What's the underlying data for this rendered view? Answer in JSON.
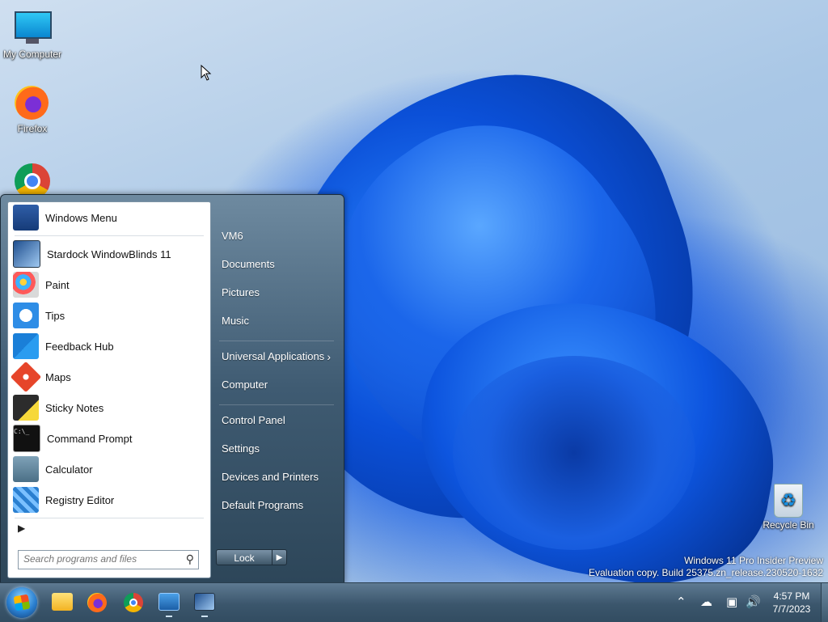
{
  "desktop": {
    "icons": [
      {
        "label": "My Computer"
      },
      {
        "label": "Firefox"
      },
      {
        "label": "Recycle Bin"
      }
    ],
    "watermark_line1": "Windows 11 Pro Insider Preview",
    "watermark_line2": "Evaluation copy. Build 25375.zn_release.230520-1632"
  },
  "start_menu": {
    "programs": [
      {
        "label": "Windows Menu",
        "icon": "windows-menu-icon"
      },
      {
        "label": "Stardock WindowBlinds 11",
        "icon": "windowblinds-icon"
      },
      {
        "label": "Paint",
        "icon": "paint-icon"
      },
      {
        "label": "Tips",
        "icon": "tips-icon"
      },
      {
        "label": "Feedback Hub",
        "icon": "feedback-hub-icon"
      },
      {
        "label": "Maps",
        "icon": "maps-icon"
      },
      {
        "label": "Sticky Notes",
        "icon": "sticky-notes-icon"
      },
      {
        "label": "Command Prompt",
        "icon": "command-prompt-icon"
      },
      {
        "label": "Calculator",
        "icon": "calculator-icon"
      },
      {
        "label": "Registry Editor",
        "icon": "registry-editor-icon"
      }
    ],
    "cmd_icon_text": "C:\\_",
    "search_placeholder": "Search programs and files",
    "places": {
      "group1": [
        "VM6",
        "Documents",
        "Pictures",
        "Music"
      ],
      "universal": "Universal Applications",
      "computer": "Computer",
      "group3": [
        "Control Panel",
        "Settings",
        "Devices and Printers",
        "Default Programs"
      ]
    },
    "lock_label": "Lock"
  },
  "taskbar": {
    "time": "4:57 PM",
    "date": "7/7/2023"
  }
}
